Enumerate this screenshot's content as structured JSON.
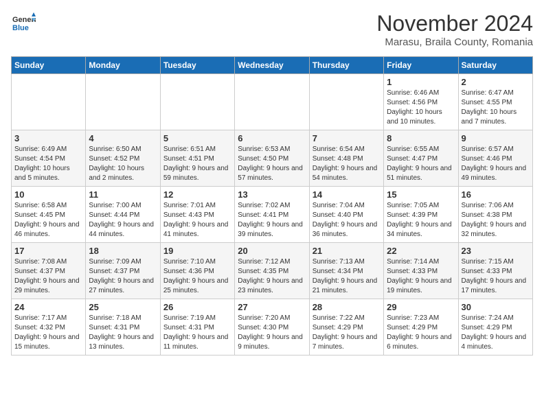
{
  "header": {
    "logo_line1": "General",
    "logo_line2": "Blue",
    "month": "November 2024",
    "location": "Marasu, Braila County, Romania"
  },
  "days_of_week": [
    "Sunday",
    "Monday",
    "Tuesday",
    "Wednesday",
    "Thursday",
    "Friday",
    "Saturday"
  ],
  "weeks": [
    [
      {
        "day": "",
        "info": ""
      },
      {
        "day": "",
        "info": ""
      },
      {
        "day": "",
        "info": ""
      },
      {
        "day": "",
        "info": ""
      },
      {
        "day": "",
        "info": ""
      },
      {
        "day": "1",
        "info": "Sunrise: 6:46 AM\nSunset: 4:56 PM\nDaylight: 10 hours and 10 minutes."
      },
      {
        "day": "2",
        "info": "Sunrise: 6:47 AM\nSunset: 4:55 PM\nDaylight: 10 hours and 7 minutes."
      }
    ],
    [
      {
        "day": "3",
        "info": "Sunrise: 6:49 AM\nSunset: 4:54 PM\nDaylight: 10 hours and 5 minutes."
      },
      {
        "day": "4",
        "info": "Sunrise: 6:50 AM\nSunset: 4:52 PM\nDaylight: 10 hours and 2 minutes."
      },
      {
        "day": "5",
        "info": "Sunrise: 6:51 AM\nSunset: 4:51 PM\nDaylight: 9 hours and 59 minutes."
      },
      {
        "day": "6",
        "info": "Sunrise: 6:53 AM\nSunset: 4:50 PM\nDaylight: 9 hours and 57 minutes."
      },
      {
        "day": "7",
        "info": "Sunrise: 6:54 AM\nSunset: 4:48 PM\nDaylight: 9 hours and 54 minutes."
      },
      {
        "day": "8",
        "info": "Sunrise: 6:55 AM\nSunset: 4:47 PM\nDaylight: 9 hours and 51 minutes."
      },
      {
        "day": "9",
        "info": "Sunrise: 6:57 AM\nSunset: 4:46 PM\nDaylight: 9 hours and 49 minutes."
      }
    ],
    [
      {
        "day": "10",
        "info": "Sunrise: 6:58 AM\nSunset: 4:45 PM\nDaylight: 9 hours and 46 minutes."
      },
      {
        "day": "11",
        "info": "Sunrise: 7:00 AM\nSunset: 4:44 PM\nDaylight: 9 hours and 44 minutes."
      },
      {
        "day": "12",
        "info": "Sunrise: 7:01 AM\nSunset: 4:43 PM\nDaylight: 9 hours and 41 minutes."
      },
      {
        "day": "13",
        "info": "Sunrise: 7:02 AM\nSunset: 4:41 PM\nDaylight: 9 hours and 39 minutes."
      },
      {
        "day": "14",
        "info": "Sunrise: 7:04 AM\nSunset: 4:40 PM\nDaylight: 9 hours and 36 minutes."
      },
      {
        "day": "15",
        "info": "Sunrise: 7:05 AM\nSunset: 4:39 PM\nDaylight: 9 hours and 34 minutes."
      },
      {
        "day": "16",
        "info": "Sunrise: 7:06 AM\nSunset: 4:38 PM\nDaylight: 9 hours and 32 minutes."
      }
    ],
    [
      {
        "day": "17",
        "info": "Sunrise: 7:08 AM\nSunset: 4:37 PM\nDaylight: 9 hours and 29 minutes."
      },
      {
        "day": "18",
        "info": "Sunrise: 7:09 AM\nSunset: 4:37 PM\nDaylight: 9 hours and 27 minutes."
      },
      {
        "day": "19",
        "info": "Sunrise: 7:10 AM\nSunset: 4:36 PM\nDaylight: 9 hours and 25 minutes."
      },
      {
        "day": "20",
        "info": "Sunrise: 7:12 AM\nSunset: 4:35 PM\nDaylight: 9 hours and 23 minutes."
      },
      {
        "day": "21",
        "info": "Sunrise: 7:13 AM\nSunset: 4:34 PM\nDaylight: 9 hours and 21 minutes."
      },
      {
        "day": "22",
        "info": "Sunrise: 7:14 AM\nSunset: 4:33 PM\nDaylight: 9 hours and 19 minutes."
      },
      {
        "day": "23",
        "info": "Sunrise: 7:15 AM\nSunset: 4:33 PM\nDaylight: 9 hours and 17 minutes."
      }
    ],
    [
      {
        "day": "24",
        "info": "Sunrise: 7:17 AM\nSunset: 4:32 PM\nDaylight: 9 hours and 15 minutes."
      },
      {
        "day": "25",
        "info": "Sunrise: 7:18 AM\nSunset: 4:31 PM\nDaylight: 9 hours and 13 minutes."
      },
      {
        "day": "26",
        "info": "Sunrise: 7:19 AM\nSunset: 4:31 PM\nDaylight: 9 hours and 11 minutes."
      },
      {
        "day": "27",
        "info": "Sunrise: 7:20 AM\nSunset: 4:30 PM\nDaylight: 9 hours and 9 minutes."
      },
      {
        "day": "28",
        "info": "Sunrise: 7:22 AM\nSunset: 4:29 PM\nDaylight: 9 hours and 7 minutes."
      },
      {
        "day": "29",
        "info": "Sunrise: 7:23 AM\nSunset: 4:29 PM\nDaylight: 9 hours and 6 minutes."
      },
      {
        "day": "30",
        "info": "Sunrise: 7:24 AM\nSunset: 4:29 PM\nDaylight: 9 hours and 4 minutes."
      }
    ]
  ]
}
